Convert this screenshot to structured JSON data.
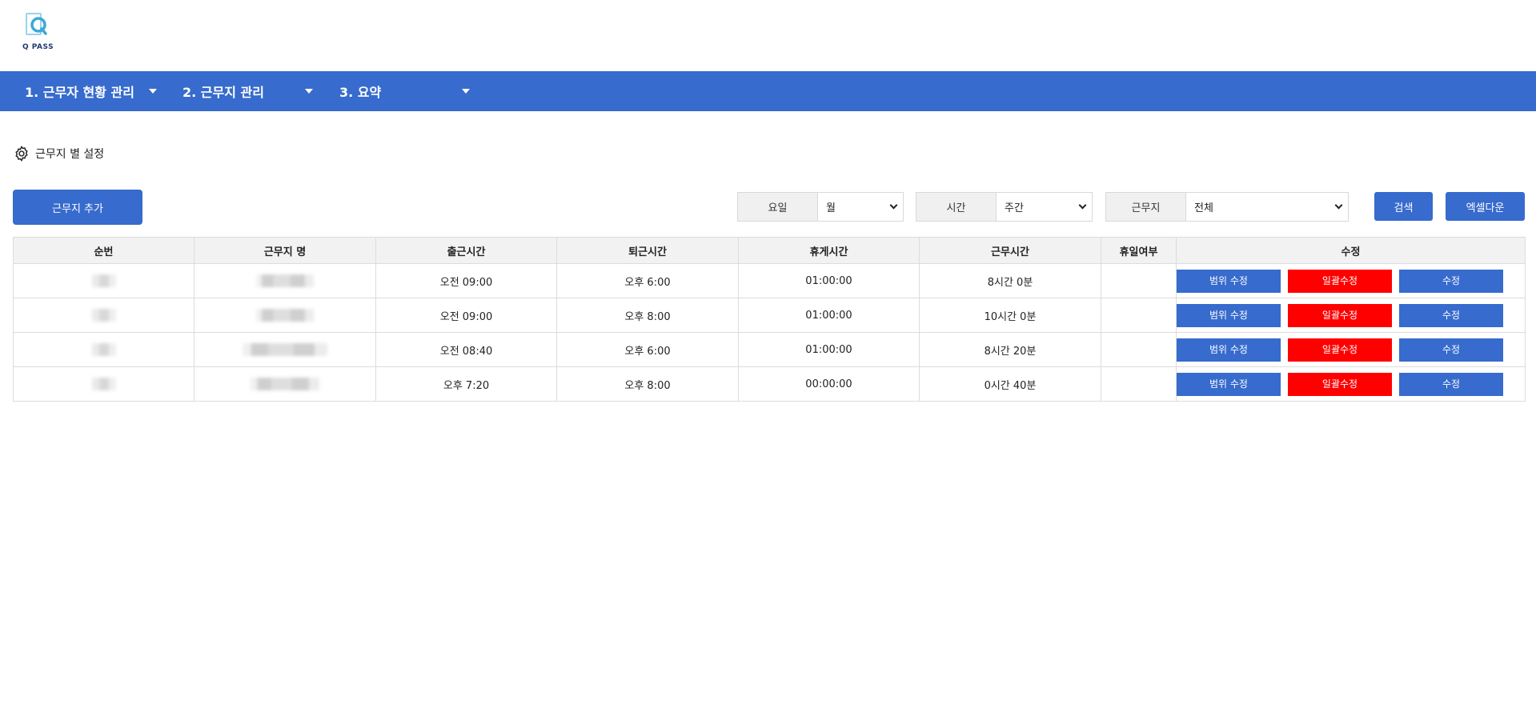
{
  "logo": {
    "text": "Q PASS",
    "mark_color": "#4cb8dc"
  },
  "nav": {
    "items": [
      {
        "label": "1. 근무자 현황 관리"
      },
      {
        "label": "2. 근무지 관리"
      },
      {
        "label": "3. 요약"
      }
    ],
    "background": "#376bcd"
  },
  "section": {
    "title": "근무지 별 설정",
    "icon": "gear-icon"
  },
  "toolbar": {
    "add_label": "근무지 추가",
    "search_label": "검색",
    "excel_label": "엑셀다운"
  },
  "filters": {
    "day": {
      "label": "요일",
      "value": "월"
    },
    "time": {
      "label": "시간",
      "value": "주간"
    },
    "site": {
      "label": "근무지",
      "value": "전체"
    }
  },
  "table": {
    "headers": [
      "순번",
      "근무지 명",
      "출근시간",
      "퇴근시간",
      "휴게시간",
      "근무시간",
      "휴일여부",
      "수정"
    ],
    "rows": [
      {
        "start": "오전 09:00",
        "end": "오후 6:00",
        "break": "01:00:00",
        "work": "8시간 0분",
        "holiday": ""
      },
      {
        "start": "오전 09:00",
        "end": "오후 8:00",
        "break": "01:00:00",
        "work": "10시간 0분",
        "holiday": ""
      },
      {
        "start": "오전 08:40",
        "end": "오후 6:00",
        "break": "01:00:00",
        "work": "8시간 20분",
        "holiday": ""
      },
      {
        "start": "오후 7:20",
        "end": "오후 8:00",
        "break": "00:00:00",
        "work": "0시간 40분",
        "holiday": ""
      }
    ],
    "actions": {
      "range_edit": "범위 수정",
      "bulk_edit": "일괄수정",
      "edit": "수정"
    }
  },
  "colors": {
    "primary": "#376bcd",
    "danger": "#ff0000",
    "header_bg": "#f2f2f2"
  }
}
